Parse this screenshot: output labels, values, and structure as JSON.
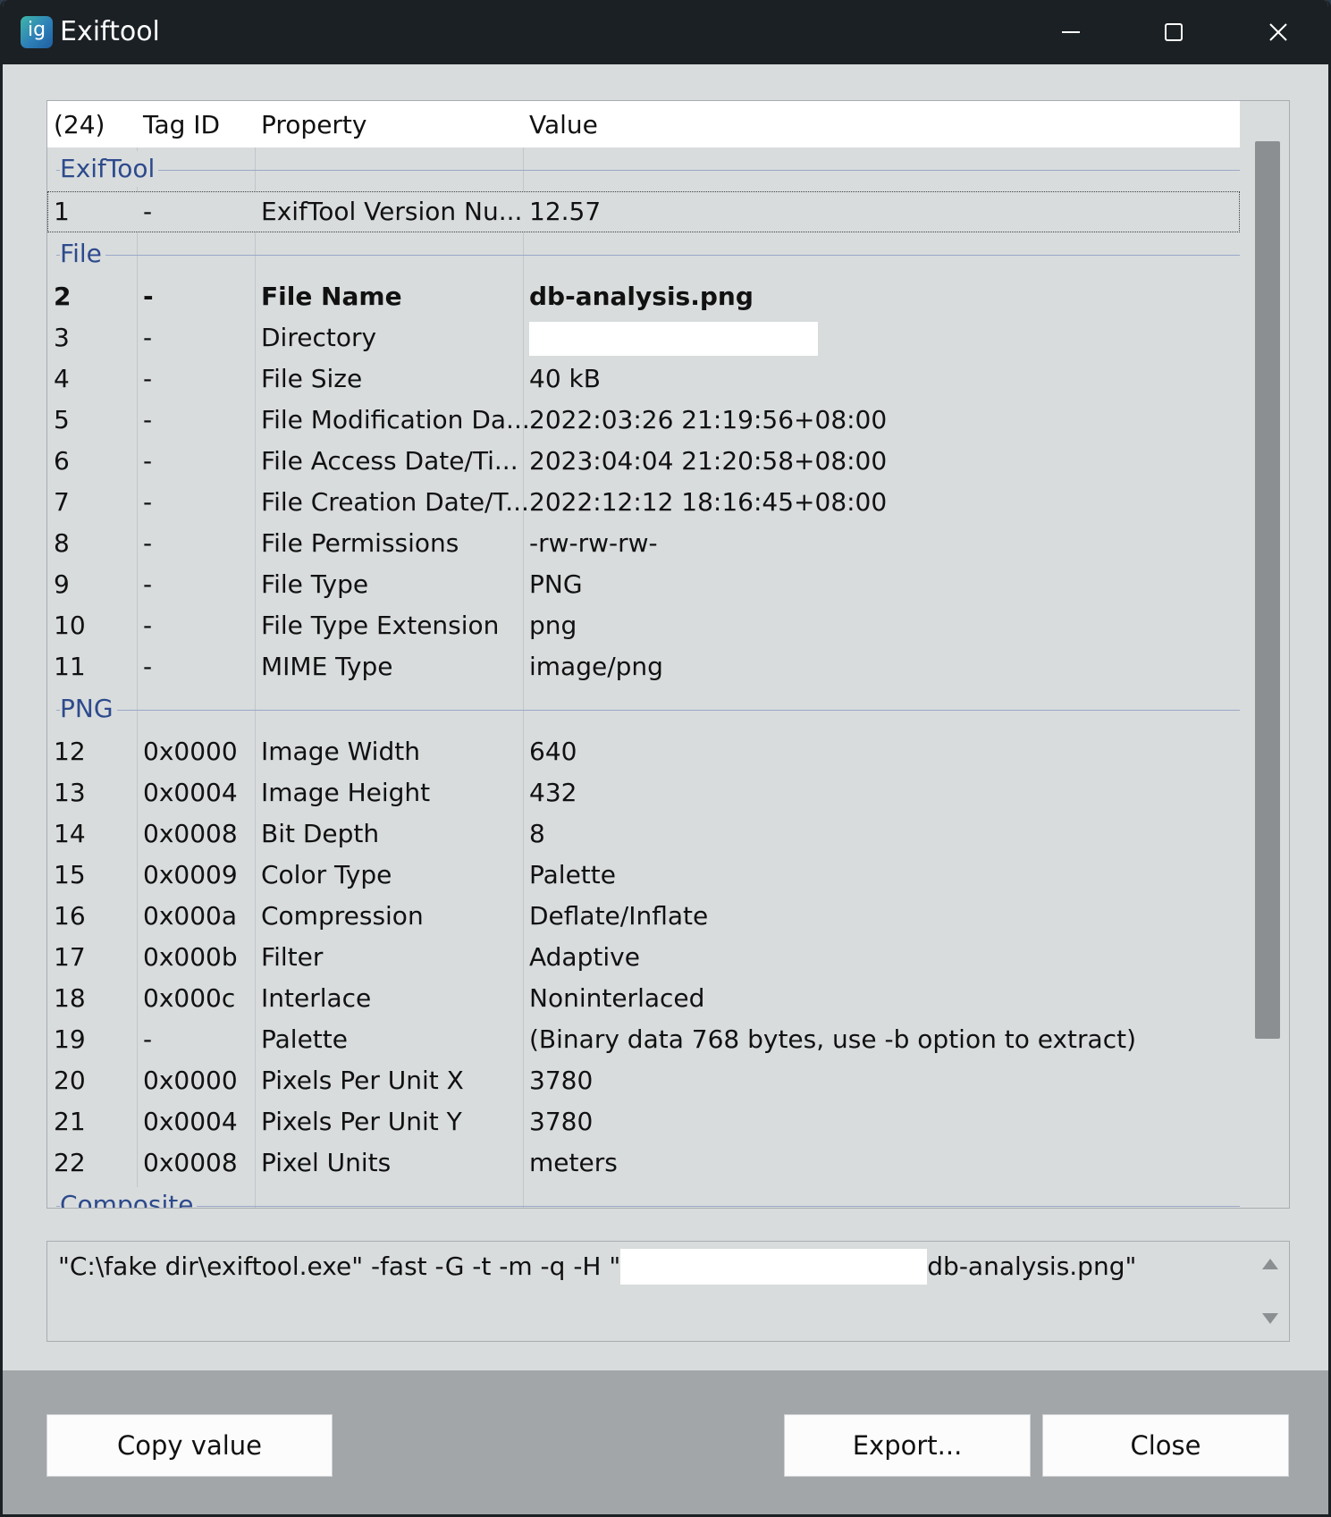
{
  "window": {
    "title": "Exiftool",
    "app_icon_text": "ig"
  },
  "table": {
    "headers": {
      "count": "(24)",
      "tag_id": "Tag ID",
      "property": "Property",
      "value": "Value"
    },
    "groups": [
      {
        "label": "ExifTool",
        "rows": [
          {
            "num": "1",
            "tag": "-",
            "property": "ExifTool Version Nu...",
            "value": "12.57",
            "selected": true
          }
        ]
      },
      {
        "label": "File",
        "rows": [
          {
            "num": "2",
            "tag": "-",
            "property": "File Name",
            "value": "db-analysis.png",
            "bold": true
          },
          {
            "num": "3",
            "tag": "-",
            "property": "Directory",
            "value": "",
            "redacted": true
          },
          {
            "num": "4",
            "tag": "-",
            "property": "File Size",
            "value": "40 kB"
          },
          {
            "num": "5",
            "tag": "-",
            "property": "File Modification Da...",
            "value": "2022:03:26 21:19:56+08:00"
          },
          {
            "num": "6",
            "tag": "-",
            "property": "File Access Date/Ti...",
            "value": "2023:04:04 21:20:58+08:00"
          },
          {
            "num": "7",
            "tag": "-",
            "property": "File Creation Date/T...",
            "value": "2022:12:12 18:16:45+08:00"
          },
          {
            "num": "8",
            "tag": "-",
            "property": "File Permissions",
            "value": "-rw-rw-rw-"
          },
          {
            "num": "9",
            "tag": "-",
            "property": "File Type",
            "value": "PNG"
          },
          {
            "num": "10",
            "tag": "-",
            "property": "File Type Extension",
            "value": "png"
          },
          {
            "num": "11",
            "tag": "-",
            "property": "MIME Type",
            "value": "image/png"
          }
        ]
      },
      {
        "label": "PNG",
        "rows": [
          {
            "num": "12",
            "tag": "0x0000",
            "property": "Image Width",
            "value": "640"
          },
          {
            "num": "13",
            "tag": "0x0004",
            "property": "Image Height",
            "value": "432"
          },
          {
            "num": "14",
            "tag": "0x0008",
            "property": "Bit Depth",
            "value": "8"
          },
          {
            "num": "15",
            "tag": "0x0009",
            "property": "Color Type",
            "value": "Palette"
          },
          {
            "num": "16",
            "tag": "0x000a",
            "property": "Compression",
            "value": "Deflate/Inflate"
          },
          {
            "num": "17",
            "tag": "0x000b",
            "property": "Filter",
            "value": "Adaptive"
          },
          {
            "num": "18",
            "tag": "0x000c",
            "property": "Interlace",
            "value": "Noninterlaced"
          },
          {
            "num": "19",
            "tag": "-",
            "property": "Palette",
            "value": "(Binary data 768 bytes, use -b option to extract)"
          },
          {
            "num": "20",
            "tag": "0x0000",
            "property": "Pixels Per Unit X",
            "value": "3780"
          },
          {
            "num": "21",
            "tag": "0x0004",
            "property": "Pixels Per Unit Y",
            "value": "3780"
          },
          {
            "num": "22",
            "tag": "0x0008",
            "property": "Pixel Units",
            "value": "meters"
          }
        ]
      },
      {
        "label": "Composite",
        "rows": []
      }
    ]
  },
  "command": {
    "prefix": "\"C:\\fake dir\\exiftool.exe\" -fast -G -t -m -q -H  \"",
    "suffix": "db-analysis.png\""
  },
  "buttons": {
    "copy": "Copy value",
    "export": "Export...",
    "close": "Close"
  },
  "colors": {
    "titlebar": "#1b2024",
    "group_label": "#2d4a8c",
    "scrollbar_thumb": "#8c8f91",
    "footer": "#a2a6a8"
  }
}
